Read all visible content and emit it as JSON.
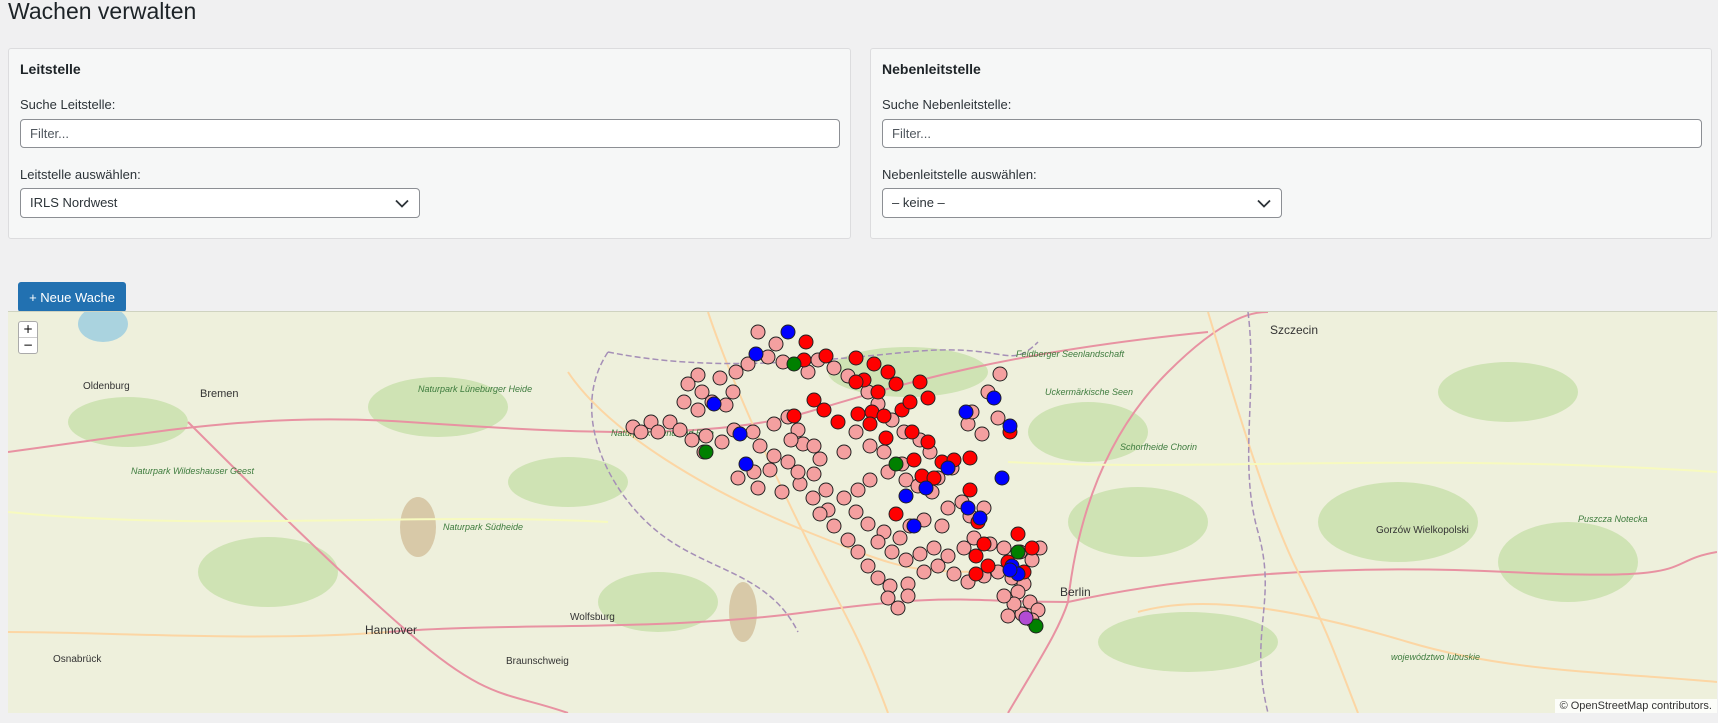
{
  "header": {
    "title": "Wachen verwalten"
  },
  "leitstelle": {
    "heading": "Leitstelle",
    "search_label": "Suche Leitstelle:",
    "search_placeholder": "Filter...",
    "select_label": "Leitstelle auswählen:",
    "select_value": "IRLS Nordwest"
  },
  "nebenleitstelle": {
    "heading": "Nebenleitstelle",
    "search_label": "Suche Nebenleitstelle:",
    "search_placeholder": "Filter...",
    "select_label": "Nebenleitstelle auswählen:",
    "select_value": "– keine –"
  },
  "toolbar": {
    "new_station_label": "+ Neue Wache"
  },
  "map": {
    "zoom_in": "+",
    "zoom_out": "−",
    "attribution": "© OpenStreetMap contributors.",
    "cities": [
      "Szczecin",
      "Oldenburg",
      "Bremen",
      "Berlin",
      "Hannover",
      "Wolfsburg",
      "Braunschweig",
      "Osnabrück",
      "Gorzów Wielkopolski"
    ],
    "region_labels": [
      "Naturpark Lüneburger Heide",
      "Naturpark Wendland Elbe",
      "Naturpark Wildeshauser Geest",
      "Naturpark Südheide",
      "Feldberger Seenlandschaft",
      "Uckermärkische Seen",
      "Schorfheide Chorin",
      "Puszcza Notecka",
      "województwo lubuskie"
    ],
    "colors": {
      "pink": "#f4a0a0",
      "red": "#ff0000",
      "blue": "#0000ff",
      "green": "#008000",
      "purple": "#b24bd4"
    }
  }
}
